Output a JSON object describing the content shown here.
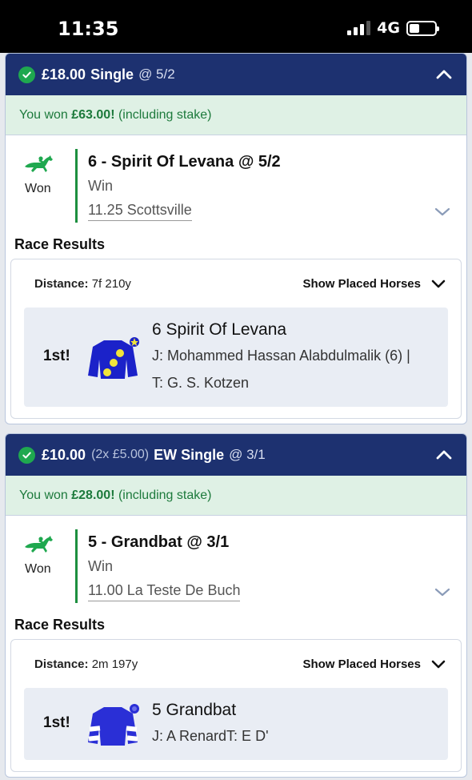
{
  "status_bar": {
    "time": "11:35",
    "network": "4G"
  },
  "bets": [
    {
      "stake": "£18.00",
      "ew_breakdown": "",
      "bet_type": "Single",
      "odds": "@ 5/2",
      "won_prefix": "You won",
      "won_amount": "£63.00!",
      "won_suffix": "(including stake)",
      "status_label": "Won",
      "selection": "6 - Spirit Of Levana @ 5/2",
      "market": "Win",
      "race": "11.25 Scottsville",
      "results_title": "Race Results",
      "distance_label": "Distance:",
      "distance_value": "7f 210y",
      "show_placed_label": "Show Placed Horses",
      "result": {
        "position": "1st!",
        "horse": "6 Spirit Of Levana",
        "jockey_line": "J: Mohammed Hassan Alabdulmalik (6) |",
        "trainer_line": "T: G. S. Kotzen"
      }
    },
    {
      "stake": "£10.00",
      "ew_breakdown": "(2x £5.00)",
      "bet_type": "EW Single",
      "odds": "@ 3/1",
      "won_prefix": "You won",
      "won_amount": "£28.00!",
      "won_suffix": "(including stake)",
      "status_label": "Won",
      "selection": "5 - Grandbat @ 3/1",
      "market": "Win",
      "race": "11.00 La Teste De Buch",
      "results_title": "Race Results",
      "distance_label": "Distance:",
      "distance_value": "2m 197y",
      "show_placed_label": "Show Placed Horses",
      "result": {
        "position": "1st!",
        "horse": "5 Grandbat",
        "jockey_line": "J: A RenardT: E D'",
        "trainer_line": ""
      }
    }
  ],
  "colors": {
    "header": "#1d3170",
    "won_green": "#1fa84f",
    "banner": "#dff1e5"
  }
}
